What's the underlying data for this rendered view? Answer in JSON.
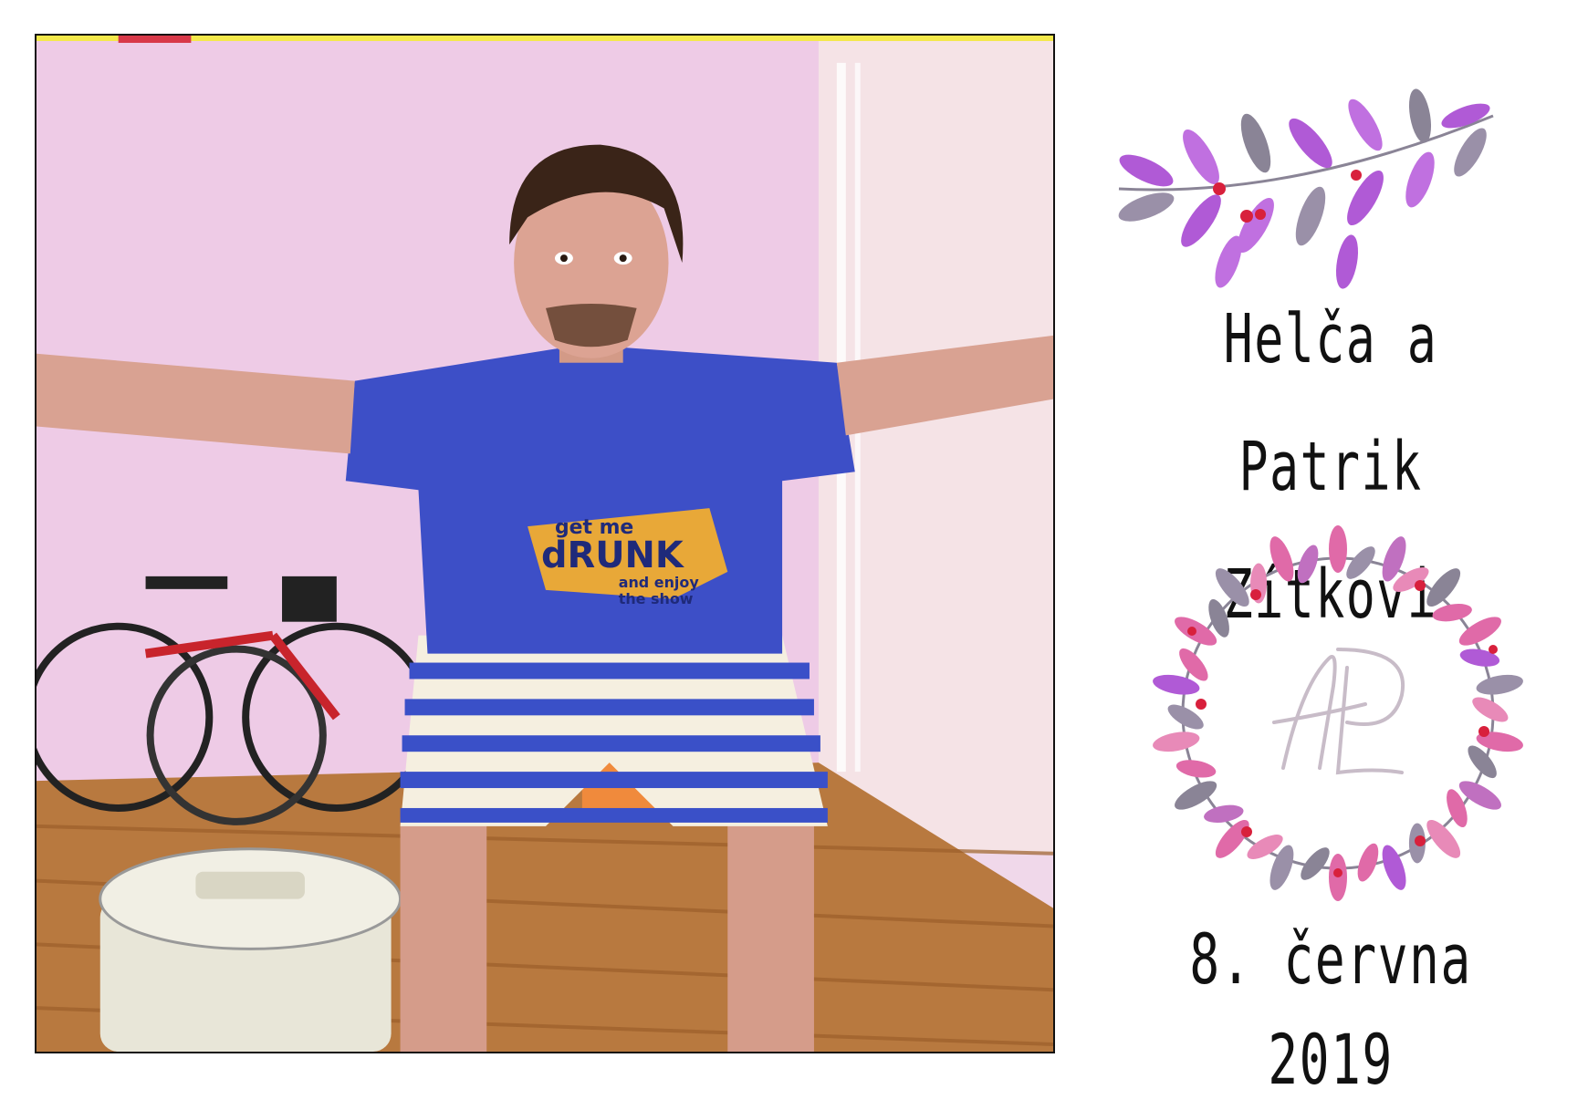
{
  "card": {
    "names_line1": "Helča a Patrik",
    "names_line2": "Zítkovi",
    "date": "8. června 2019"
  },
  "photo": {
    "shirt_text_line1": "get me",
    "shirt_text_line2": "dRUNK",
    "shirt_text_line3": "and enjoy",
    "shirt_text_line4": "the show"
  },
  "colors": {
    "leaf_purple": "#b05ad6",
    "leaf_pink": "#e06aa8",
    "leaf_grey": "#8a8496",
    "berry_red": "#d8203c",
    "wall_pink": "#f3d9ee",
    "shirt_blue": "#3d4fc7",
    "floor_wood": "#b8793f"
  }
}
